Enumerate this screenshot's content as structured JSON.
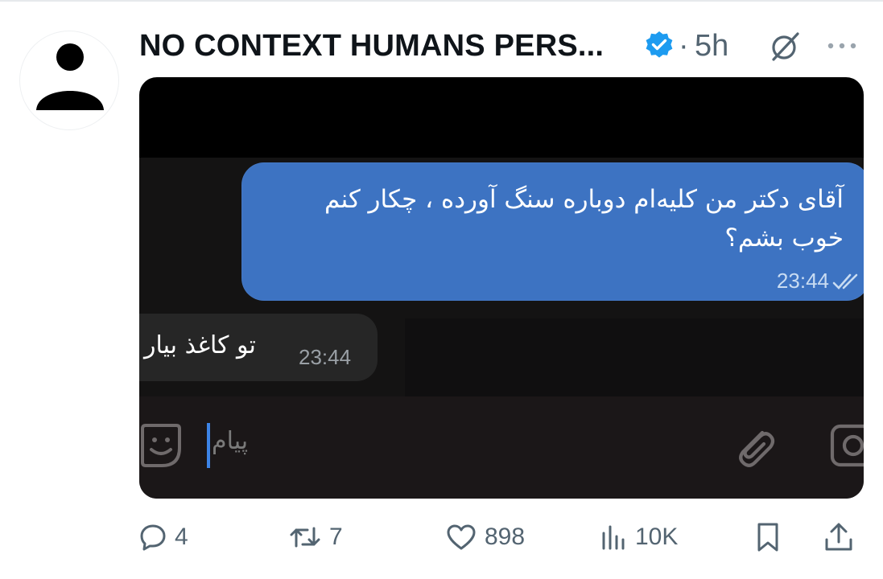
{
  "tweet": {
    "author_name": "NO CONTEXT HUMANS PERS...",
    "verified_icon": "verified-badge-icon",
    "separator": "·",
    "time": "5h",
    "colors": {
      "verified": "#1d9bf0",
      "text": "#0f1419",
      "muted": "#536471"
    }
  },
  "media": {
    "outgoing_message": "آقای دکتر من کلیه‌ام دوباره سنگ آورده ، چکار کنم\nخوب بشم؟",
    "outgoing_time": "23:44",
    "incoming_message": "تو کاغذ بیار",
    "incoming_time": "23:44",
    "input_placeholder": "پیام",
    "colors": {
      "outgoing_bubble": "#3d73c2",
      "incoming_bubble": "#262626",
      "cursor": "#3d84e6"
    }
  },
  "actions": {
    "replies": "4",
    "reposts": "7",
    "likes": "898",
    "views": "10K"
  }
}
